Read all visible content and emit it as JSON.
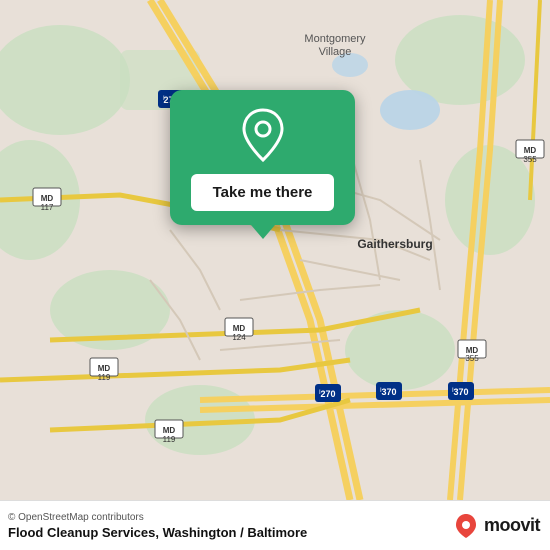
{
  "map": {
    "attribution": "© OpenStreetMap contributors",
    "place": "Flood Cleanup Services, Washington / Baltimore",
    "popup": {
      "button_label": "Take me there"
    },
    "moovit": "moovit",
    "bg_color": "#e8e0d8"
  }
}
